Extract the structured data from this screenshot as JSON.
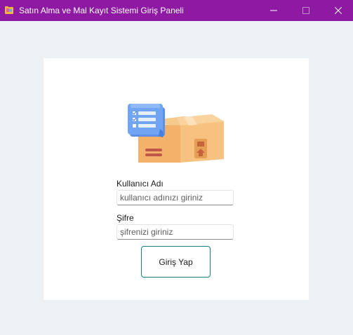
{
  "window": {
    "title": "Satın Alma ve Mal Kayıt Sistemi Giriş Paneli",
    "accent_color": "#8e1aa3",
    "controls": {
      "minimize_icon": "minimize-icon",
      "maximize_icon": "maximize-icon",
      "close_icon": "close-icon"
    }
  },
  "form": {
    "illustration_icon": "package-checklist-illustration",
    "username_label": "Kullanıcı Adı",
    "username_placeholder": "kullanıcı adınızı giriniz",
    "username_value": "",
    "password_label": "Şifre",
    "password_placeholder": "şifrenizi giriniz",
    "password_value": "",
    "login_button_label": "Giriş Yap",
    "button_border_color": "#157f83"
  }
}
